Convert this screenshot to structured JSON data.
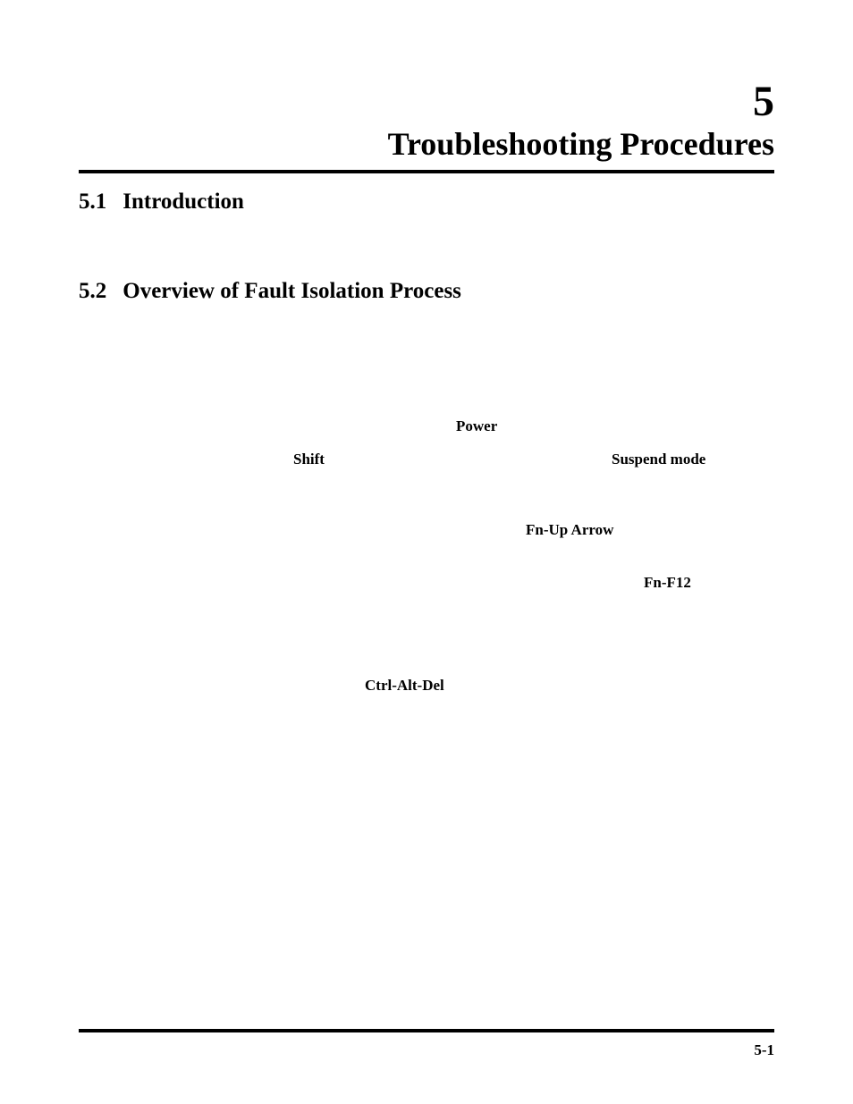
{
  "chapter": {
    "number": "5",
    "title": "Troubleshooting Procedures"
  },
  "sections": [
    {
      "number": "5.1",
      "title": "Introduction"
    },
    {
      "number": "5.2",
      "title": "Overview of Fault Isolation Process"
    }
  ],
  "keywords": {
    "power": "Power",
    "shift": "Shift",
    "suspend_mode": "Suspend mode",
    "fn_up_arrow": "Fn-Up Arrow",
    "fn_f12": "Fn-F12",
    "ctrl_alt_del": "Ctrl-Alt-Del"
  },
  "page_number": "5-1"
}
